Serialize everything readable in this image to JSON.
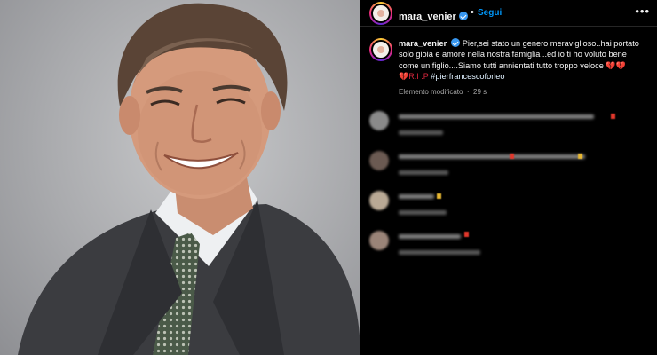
{
  "post": {
    "username": "mara_venier",
    "follow_label": "Segui",
    "header_separator": "•",
    "more_label": "•••",
    "caption_line1": "Pier,sei stato un genero meraviglioso..hai portato",
    "caption_line2": "solo gioia e amore nella nostra famiglia ..ed io ti ho voluto bene",
    "caption_line3": "come un figlio....Siamo tutti annientati tutto troppo veloce",
    "caption_hearts": "💔💔",
    "caption_line4_prefix": "💔R.I .P",
    "caption_hashtag": "#pierfrancescoforleo",
    "edited_label": "Elemento modificato",
    "time_ago": "29 s"
  },
  "comments_blurred": [
    {
      "avatar_color": "#8a8a8a",
      "has_red_mark": true
    },
    {
      "avatar_color": "#6b5a52",
      "has_red_mark": true
    },
    {
      "avatar_color": "#b9a995",
      "has_red_mark": false
    },
    {
      "avatar_color": "#9a8478",
      "has_red_mark": true
    }
  ],
  "colors": {
    "background": "#000000",
    "follow_blue": "#0095f6",
    "verified_blue": "#3897f0",
    "meta_gray": "#a8a8a8",
    "heart_red": "#d7263d"
  },
  "icons": [
    "verified-badge-icon",
    "more-options-icon",
    "broken-heart-icon"
  ]
}
